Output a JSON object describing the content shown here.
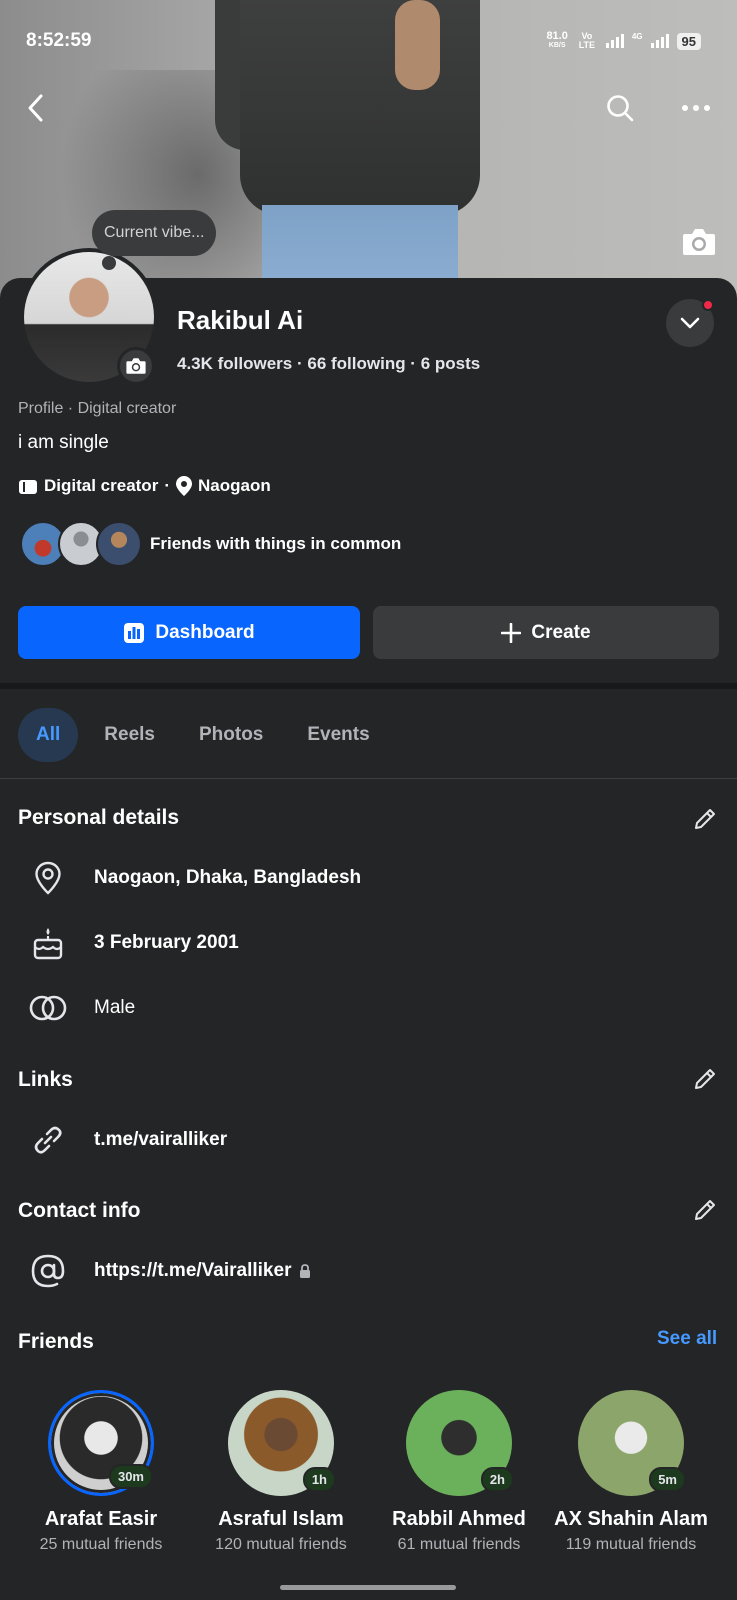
{
  "status_bar": {
    "time": "8:52:59",
    "net_speed": "81.0",
    "net_unit": "KB/S",
    "volte": "Vo LTE",
    "signal2_label": "4G",
    "battery": "95"
  },
  "header": {
    "vibe_bubble": "Current vibe..."
  },
  "profile": {
    "name": "Rakibul Ai",
    "stats": "4.3K followers · 66 following · 6 posts",
    "category_line": "Profile · Digital creator",
    "bio": "i am single",
    "work": "Digital creator",
    "location": "Naogaon",
    "meta_separator": "·",
    "friends_common": "Friends with things in common"
  },
  "actions": {
    "dashboard_label": "Dashboard",
    "create_label": "Create"
  },
  "tabs": [
    {
      "label": "All",
      "active": true
    },
    {
      "label": "Reels",
      "active": false
    },
    {
      "label": "Photos",
      "active": false
    },
    {
      "label": "Events",
      "active": false
    }
  ],
  "personal_details": {
    "title": "Personal details",
    "location": "Naogaon, Dhaka, Bangladesh",
    "birthday": "3 February 2001",
    "gender": "Male"
  },
  "links": {
    "title": "Links",
    "url": "t.me/vairalliker"
  },
  "contact": {
    "title": "Contact info",
    "url": "https://t.me/Vairalliker"
  },
  "friends": {
    "title": "Friends",
    "see_all": "See all",
    "items": [
      {
        "name": "Arafat Easir",
        "time": "30m",
        "mutual": "25 mutual friends"
      },
      {
        "name": "Asraful Islam",
        "time": "1h",
        "mutual": "120 mutual friends"
      },
      {
        "name": "Rabbil Ahmed",
        "time": "2h",
        "mutual": "61 mutual friends"
      },
      {
        "name": "AX Shahin Alam",
        "time": "5m",
        "mutual": "119 mutual friends"
      }
    ]
  },
  "colors": {
    "accent": "#0866ff",
    "background": "#242526",
    "link": "#4599ff"
  }
}
